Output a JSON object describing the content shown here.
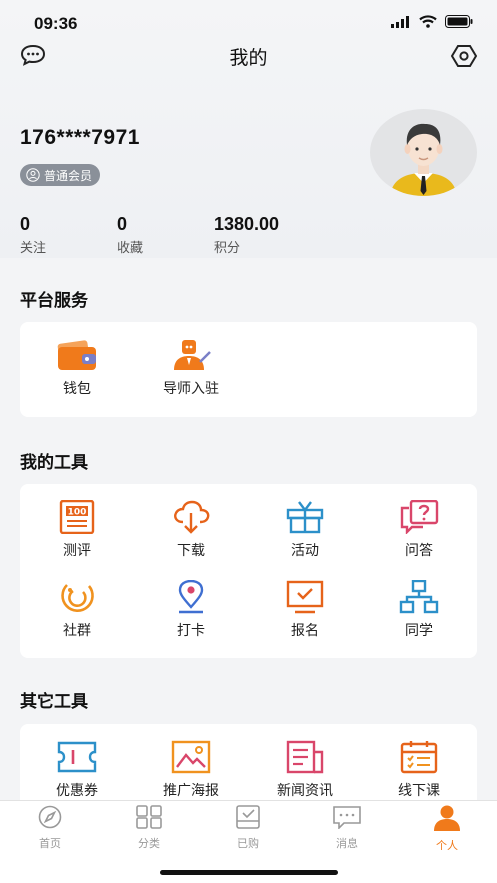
{
  "status_bar": {
    "time": "09:36"
  },
  "nav": {
    "title": "我的",
    "left_icon": "message-icon",
    "right_icon": "settings-icon"
  },
  "profile": {
    "phone": "176****7971",
    "member_level": "普通会员"
  },
  "stats": [
    {
      "value": "0",
      "label": "关注"
    },
    {
      "value": "0",
      "label": "收藏"
    },
    {
      "value": "1380.00",
      "label": "积分"
    }
  ],
  "platform_services": {
    "title": "平台服务",
    "items": [
      {
        "label": "钱包",
        "icon": "wallet-icon"
      },
      {
        "label": "导师入驻",
        "icon": "mentor-icon"
      }
    ]
  },
  "my_tools": {
    "title": "我的工具",
    "items": [
      {
        "label": "测评",
        "icon": "score-icon"
      },
      {
        "label": "下载",
        "icon": "cloud-download-icon"
      },
      {
        "label": "活动",
        "icon": "gift-icon"
      },
      {
        "label": "问答",
        "icon": "question-icon"
      },
      {
        "label": "社群",
        "icon": "community-icon"
      },
      {
        "label": "打卡",
        "icon": "location-pin-icon"
      },
      {
        "label": "报名",
        "icon": "monitor-check-icon"
      },
      {
        "label": "同学",
        "icon": "org-chart-icon"
      }
    ]
  },
  "other_tools": {
    "title": "其它工具",
    "items": [
      {
        "label": "优惠券",
        "icon": "coupon-icon"
      },
      {
        "label": "推广海报",
        "icon": "poster-icon"
      },
      {
        "label": "新闻资讯",
        "icon": "news-icon"
      },
      {
        "label": "线下课",
        "icon": "calendar-icon"
      }
    ]
  },
  "tabbar": [
    {
      "label": "首页",
      "icon": "compass-icon",
      "active": false
    },
    {
      "label": "分类",
      "icon": "grid-icon",
      "active": false
    },
    {
      "label": "已购",
      "icon": "purchased-icon",
      "active": false
    },
    {
      "label": "消息",
      "icon": "chat-icon",
      "active": false
    },
    {
      "label": "个人",
      "icon": "person-icon",
      "active": true
    }
  ],
  "colors": {
    "accent": "#f07a1b",
    "tab_inactive": "#999999",
    "background": "#f3f4f6"
  }
}
